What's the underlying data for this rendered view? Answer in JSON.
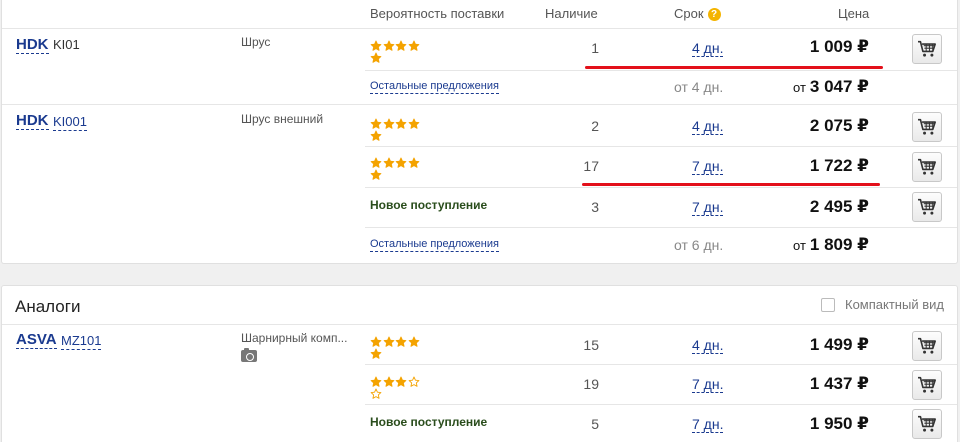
{
  "header": {
    "probability": "Вероятность поставки",
    "availability": "Наличие",
    "term": "Срок",
    "term_help": "?",
    "price": "Цена"
  },
  "group1": {
    "brand": "HDK",
    "article": "KI01",
    "description": "Шрус",
    "offer1": {
      "rating": 5,
      "qty": "1",
      "term": "4 дн.",
      "price": "1 009 ₽"
    },
    "others": {
      "label": "Остальные предложения",
      "term": "от 4 дн.",
      "price_prefix": "от",
      "price": "3 047 ₽"
    }
  },
  "group2": {
    "brand": "HDK",
    "article": "KI001",
    "description": "Шрус внешний",
    "offer1": {
      "rating": 5,
      "qty": "2",
      "term": "4 дн.",
      "price": "2 075 ₽"
    },
    "offer2": {
      "rating": 5,
      "qty": "17",
      "term": "7 дн.",
      "price": "1 722 ₽"
    },
    "offer3": {
      "label": "Новое поступление",
      "qty": "3",
      "term": "7 дн.",
      "price": "2 495 ₽"
    },
    "others": {
      "label": "Остальные предложения",
      "term": "от 6 дн.",
      "price_prefix": "от",
      "price": "1 809 ₽"
    }
  },
  "analogs": {
    "title": "Аналоги",
    "compact_label": "Компактный вид",
    "compact_checked": false,
    "group3": {
      "brand": "ASVA",
      "article": "MZ101",
      "description": "Шарнирный комп...",
      "offer1": {
        "rating": 5,
        "qty": "15",
        "term": "4 дн.",
        "price": "1 499 ₽"
      },
      "offer2": {
        "rating": 3,
        "qty": "19",
        "term": "7 дн.",
        "price": "1 437 ₽"
      },
      "offer3": {
        "label": "Новое поступление",
        "qty": "5",
        "term": "7 дн.",
        "price": "1 950 ₽"
      }
    }
  },
  "icons": {
    "cart": "cart-icon",
    "star": "star-icon",
    "camera": "camera-icon",
    "help": "help-icon"
  },
  "colors": {
    "link": "#1a3a8f",
    "star_filled": "#f4a300",
    "star_empty": "#f4a300",
    "new_label": "#2a4d1c",
    "highlight": "#e3101a"
  }
}
